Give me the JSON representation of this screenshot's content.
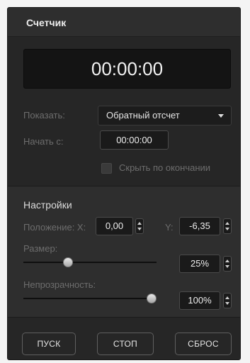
{
  "panel": {
    "title": "Счетчик"
  },
  "display": {
    "time": "00:00:00"
  },
  "show": {
    "label": "Показать:",
    "value": "Обратный отсчет"
  },
  "start": {
    "label": "Начать с:",
    "value": "00:00:00"
  },
  "hide_on_end": {
    "label": "Скрыть по окончании",
    "checked": false
  },
  "settings": {
    "title": "Настройки",
    "position_x": {
      "label": "Положение: X:",
      "value": "0,00"
    },
    "position_y": {
      "label": "Y:",
      "value": "-6,35"
    },
    "size": {
      "label": "Размер:",
      "value": "25%",
      "level": 0.25
    },
    "opacity": {
      "label": "Непрозрачность:",
      "value": "100%",
      "level": 1.0
    }
  },
  "buttons": {
    "start": "ПУСК",
    "stop": "СТОП",
    "reset": "СБРОС"
  }
}
